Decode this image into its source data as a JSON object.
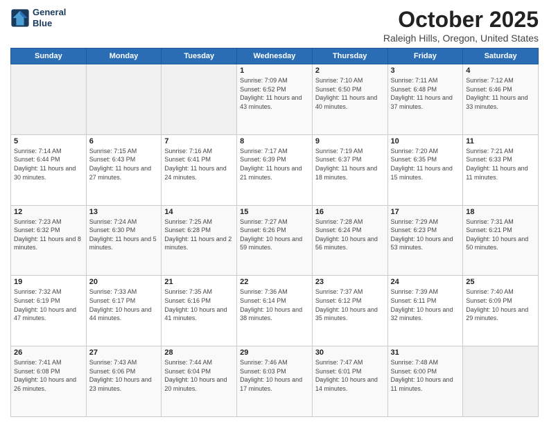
{
  "header": {
    "logo_line1": "General",
    "logo_line2": "Blue",
    "title": "October 2025",
    "subtitle": "Raleigh Hills, Oregon, United States"
  },
  "days_of_week": [
    "Sunday",
    "Monday",
    "Tuesday",
    "Wednesday",
    "Thursday",
    "Friday",
    "Saturday"
  ],
  "weeks": [
    [
      {
        "day": "",
        "info": ""
      },
      {
        "day": "",
        "info": ""
      },
      {
        "day": "",
        "info": ""
      },
      {
        "day": "1",
        "info": "Sunrise: 7:09 AM\nSunset: 6:52 PM\nDaylight: 11 hours and 43 minutes."
      },
      {
        "day": "2",
        "info": "Sunrise: 7:10 AM\nSunset: 6:50 PM\nDaylight: 11 hours and 40 minutes."
      },
      {
        "day": "3",
        "info": "Sunrise: 7:11 AM\nSunset: 6:48 PM\nDaylight: 11 hours and 37 minutes."
      },
      {
        "day": "4",
        "info": "Sunrise: 7:12 AM\nSunset: 6:46 PM\nDaylight: 11 hours and 33 minutes."
      }
    ],
    [
      {
        "day": "5",
        "info": "Sunrise: 7:14 AM\nSunset: 6:44 PM\nDaylight: 11 hours and 30 minutes."
      },
      {
        "day": "6",
        "info": "Sunrise: 7:15 AM\nSunset: 6:43 PM\nDaylight: 11 hours and 27 minutes."
      },
      {
        "day": "7",
        "info": "Sunrise: 7:16 AM\nSunset: 6:41 PM\nDaylight: 11 hours and 24 minutes."
      },
      {
        "day": "8",
        "info": "Sunrise: 7:17 AM\nSunset: 6:39 PM\nDaylight: 11 hours and 21 minutes."
      },
      {
        "day": "9",
        "info": "Sunrise: 7:19 AM\nSunset: 6:37 PM\nDaylight: 11 hours and 18 minutes."
      },
      {
        "day": "10",
        "info": "Sunrise: 7:20 AM\nSunset: 6:35 PM\nDaylight: 11 hours and 15 minutes."
      },
      {
        "day": "11",
        "info": "Sunrise: 7:21 AM\nSunset: 6:33 PM\nDaylight: 11 hours and 11 minutes."
      }
    ],
    [
      {
        "day": "12",
        "info": "Sunrise: 7:23 AM\nSunset: 6:32 PM\nDaylight: 11 hours and 8 minutes."
      },
      {
        "day": "13",
        "info": "Sunrise: 7:24 AM\nSunset: 6:30 PM\nDaylight: 11 hours and 5 minutes."
      },
      {
        "day": "14",
        "info": "Sunrise: 7:25 AM\nSunset: 6:28 PM\nDaylight: 11 hours and 2 minutes."
      },
      {
        "day": "15",
        "info": "Sunrise: 7:27 AM\nSunset: 6:26 PM\nDaylight: 10 hours and 59 minutes."
      },
      {
        "day": "16",
        "info": "Sunrise: 7:28 AM\nSunset: 6:24 PM\nDaylight: 10 hours and 56 minutes."
      },
      {
        "day": "17",
        "info": "Sunrise: 7:29 AM\nSunset: 6:23 PM\nDaylight: 10 hours and 53 minutes."
      },
      {
        "day": "18",
        "info": "Sunrise: 7:31 AM\nSunset: 6:21 PM\nDaylight: 10 hours and 50 minutes."
      }
    ],
    [
      {
        "day": "19",
        "info": "Sunrise: 7:32 AM\nSunset: 6:19 PM\nDaylight: 10 hours and 47 minutes."
      },
      {
        "day": "20",
        "info": "Sunrise: 7:33 AM\nSunset: 6:17 PM\nDaylight: 10 hours and 44 minutes."
      },
      {
        "day": "21",
        "info": "Sunrise: 7:35 AM\nSunset: 6:16 PM\nDaylight: 10 hours and 41 minutes."
      },
      {
        "day": "22",
        "info": "Sunrise: 7:36 AM\nSunset: 6:14 PM\nDaylight: 10 hours and 38 minutes."
      },
      {
        "day": "23",
        "info": "Sunrise: 7:37 AM\nSunset: 6:12 PM\nDaylight: 10 hours and 35 minutes."
      },
      {
        "day": "24",
        "info": "Sunrise: 7:39 AM\nSunset: 6:11 PM\nDaylight: 10 hours and 32 minutes."
      },
      {
        "day": "25",
        "info": "Sunrise: 7:40 AM\nSunset: 6:09 PM\nDaylight: 10 hours and 29 minutes."
      }
    ],
    [
      {
        "day": "26",
        "info": "Sunrise: 7:41 AM\nSunset: 6:08 PM\nDaylight: 10 hours and 26 minutes."
      },
      {
        "day": "27",
        "info": "Sunrise: 7:43 AM\nSunset: 6:06 PM\nDaylight: 10 hours and 23 minutes."
      },
      {
        "day": "28",
        "info": "Sunrise: 7:44 AM\nSunset: 6:04 PM\nDaylight: 10 hours and 20 minutes."
      },
      {
        "day": "29",
        "info": "Sunrise: 7:46 AM\nSunset: 6:03 PM\nDaylight: 10 hours and 17 minutes."
      },
      {
        "day": "30",
        "info": "Sunrise: 7:47 AM\nSunset: 6:01 PM\nDaylight: 10 hours and 14 minutes."
      },
      {
        "day": "31",
        "info": "Sunrise: 7:48 AM\nSunset: 6:00 PM\nDaylight: 10 hours and 11 minutes."
      },
      {
        "day": "",
        "info": ""
      }
    ]
  ]
}
